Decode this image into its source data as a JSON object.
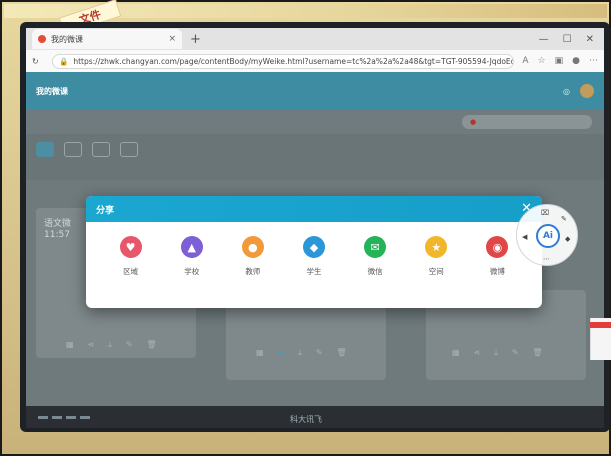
{
  "sticker": {
    "text": "文件"
  },
  "browser": {
    "tab_title": "我的微课",
    "new_tab_icon": "plus-icon",
    "url": "https://zhwk.changyan.com/page/contentBody/myWeike.html?username=tc%2a%2a%2a48&tgt=TGT-905594-JqdoEcg..."
  },
  "app": {
    "nav_active": "我的微课"
  },
  "modal": {
    "title": "分享",
    "items": [
      {
        "label": "区域",
        "icon": "region-icon",
        "color": "#e8566a",
        "glyph": "♥"
      },
      {
        "label": "学校",
        "icon": "school-icon",
        "color": "#7d5fd6",
        "glyph": "▲"
      },
      {
        "label": "教师",
        "icon": "teacher-icon",
        "color": "#f29a3a",
        "glyph": "●"
      },
      {
        "label": "学生",
        "icon": "student-icon",
        "color": "#2b97d8",
        "glyph": "◆"
      },
      {
        "label": "微信",
        "icon": "wechat-icon",
        "color": "#25b35a",
        "glyph": "✉"
      },
      {
        "label": "空间",
        "icon": "qzone-icon",
        "color": "#f2b62a",
        "glyph": "★"
      },
      {
        "label": "微博",
        "icon": "weibo-icon",
        "color": "#e04848",
        "glyph": "◉"
      }
    ]
  },
  "ai_widget": {
    "label": "Ai"
  },
  "background_card": {
    "title": "语文微",
    "time": "11:57"
  },
  "taskbar": {
    "brand": "科大讯飞"
  }
}
